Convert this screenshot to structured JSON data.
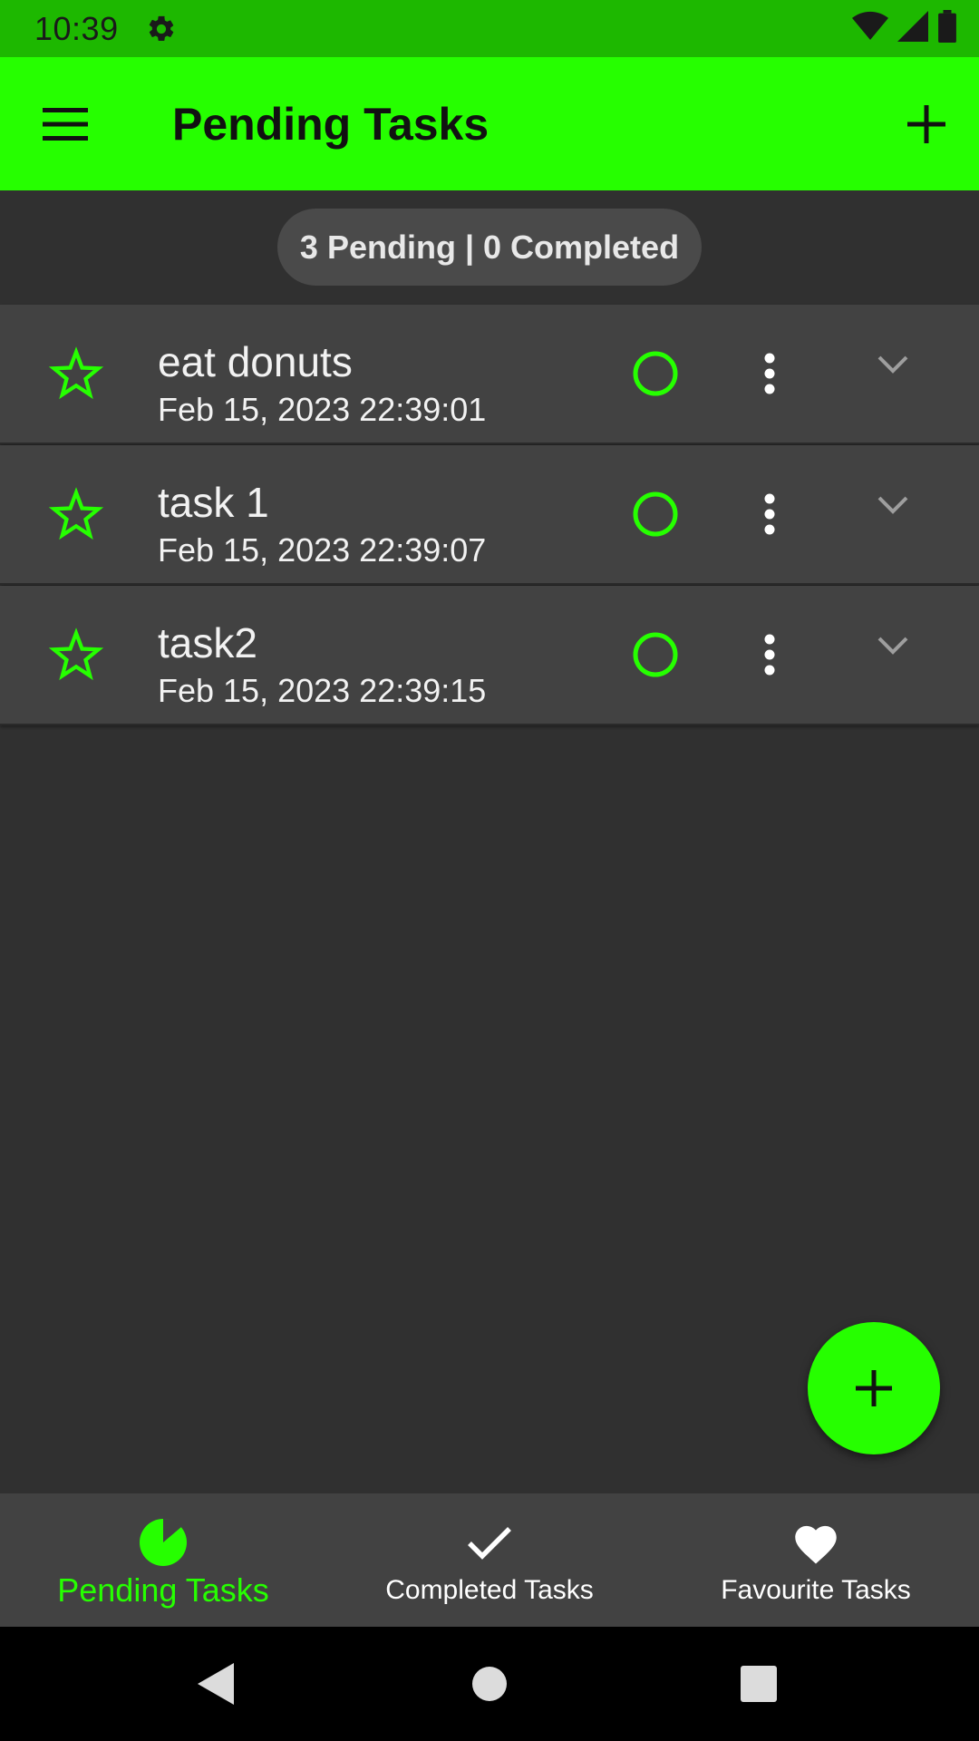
{
  "status_bar": {
    "time": "10:39",
    "icons": [
      "gear-icon",
      "wifi-icon",
      "signal-icon",
      "battery-icon"
    ]
  },
  "app_bar": {
    "title": "Pending Tasks",
    "menu_icon": "hamburger-menu-icon",
    "action_icon": "plus-icon"
  },
  "summary": {
    "text": "3 Pending | 0 Completed"
  },
  "tasks": [
    {
      "title": "eat donuts",
      "date": "Feb 15, 2023 22:39:01",
      "favourite": false,
      "completed": false
    },
    {
      "title": "task 1",
      "date": "Feb 15, 2023 22:39:07",
      "favourite": false,
      "completed": false
    },
    {
      "title": "task2",
      "date": "Feb 15, 2023 22:39:15",
      "favourite": false,
      "completed": false
    }
  ],
  "bottom_nav": {
    "items": [
      {
        "label": "Pending Tasks",
        "icon": "pie-chart-icon",
        "active": true
      },
      {
        "label": "Completed Tasks",
        "icon": "checkmark-icon",
        "active": false
      },
      {
        "label": "Favourite Tasks",
        "icon": "heart-icon",
        "active": false
      }
    ]
  },
  "colors": {
    "accent": "#26ff00",
    "status_bar": "#1db800",
    "background": "#303030",
    "card": "#424242"
  }
}
